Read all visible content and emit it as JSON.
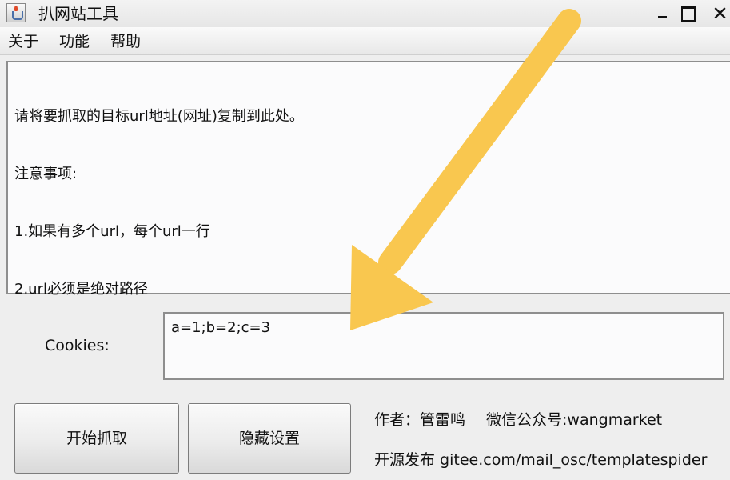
{
  "window": {
    "title": "扒网站工具",
    "close_glyph": "✕"
  },
  "menu": {
    "about": "关于",
    "function": "功能",
    "help": "帮助"
  },
  "url_input": {
    "lines": [
      "请将要抓取的目标url地址(网址)复制到此处。",
      "注意事项:",
      "1.如果有多个url，每个url一行",
      "2.url必须是绝对路径"
    ]
  },
  "cookies": {
    "label": "Cookies:",
    "value": "a=1;b=2;c=3"
  },
  "buttons": {
    "start": "开始抓取",
    "hide_settings": "隐藏设置"
  },
  "info": {
    "author": "作者：管雷鸣",
    "wechat": "微信公众号:wangmarket",
    "source": "开源发布 gitee.com/mail_osc/templatespider"
  },
  "colors": {
    "arrow": "#f9c74f",
    "background": "#eeeeee",
    "field_background": "#fbfbfc"
  },
  "icons": {
    "app": "java-cup-icon",
    "minimize": "minimize-icon",
    "maximize": "maximize-icon",
    "close": "close-icon",
    "annotation": "arrow-annotation"
  }
}
